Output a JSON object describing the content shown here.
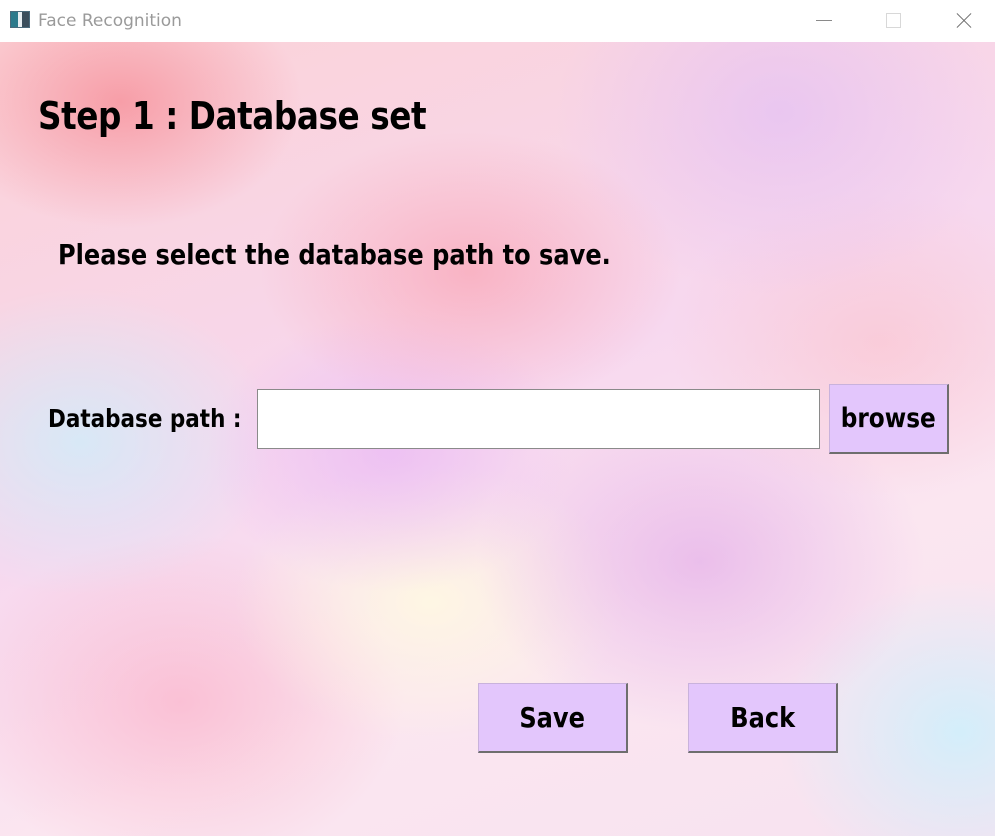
{
  "window": {
    "title": "Face Recognition",
    "icon": "app-window-icon"
  },
  "page": {
    "heading": "Step 1 : Database set",
    "instruction": "Please select the database path to save."
  },
  "form": {
    "path_label": "Database path :",
    "path_value": "",
    "path_placeholder": "",
    "browse_label": "browse"
  },
  "actions": {
    "save_label": "Save",
    "back_label": "Back"
  },
  "colors": {
    "button_bg": "#e3c6fc",
    "title_text": "#9a9a9a",
    "text": "#000000"
  }
}
